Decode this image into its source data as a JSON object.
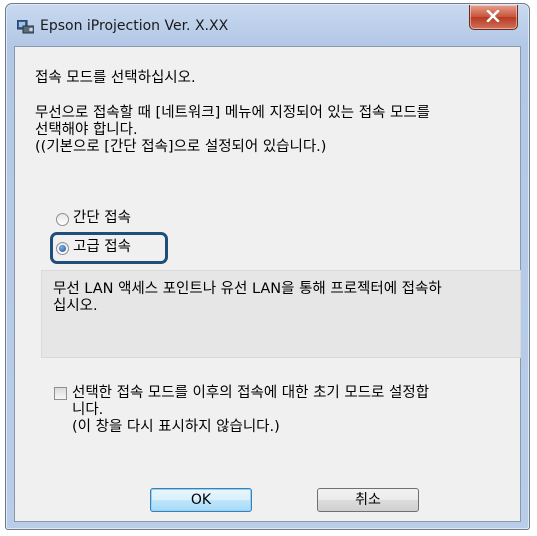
{
  "window": {
    "title": "Epson iProjection Ver. X.XX"
  },
  "dialog": {
    "prompt": "접속 모드를 선택하십시오.",
    "instructions": [
      "무선으로 접속할 때 [네트워크] 메뉴에 지정되어 있는 접속 모드를",
      "선택해야 합니다.",
      "((기본으로 [간단 접속]으로 설정되어 있습니다.)"
    ],
    "options": [
      {
        "label": "간단 접속",
        "selected": false
      },
      {
        "label": "고급 접속",
        "selected": true
      }
    ],
    "description": [
      "무선 LAN 액세스 포인트나 유선 LAN을 통해 프로젝터에 접속하",
      "십시오."
    ],
    "checkbox": {
      "checked": false,
      "label": [
        "선택한 접속 모드를 이후의 접속에 대한 초기 모드로 설정합",
        "니다.",
        "(이 창을 다시 표시하지 않습니다.)"
      ]
    },
    "buttons": {
      "ok": "OK",
      "cancel": "취소"
    }
  },
  "colors": {
    "highlight": "#1d4f7a",
    "close": "#c8533a",
    "default_button": "#3c7fb1"
  }
}
